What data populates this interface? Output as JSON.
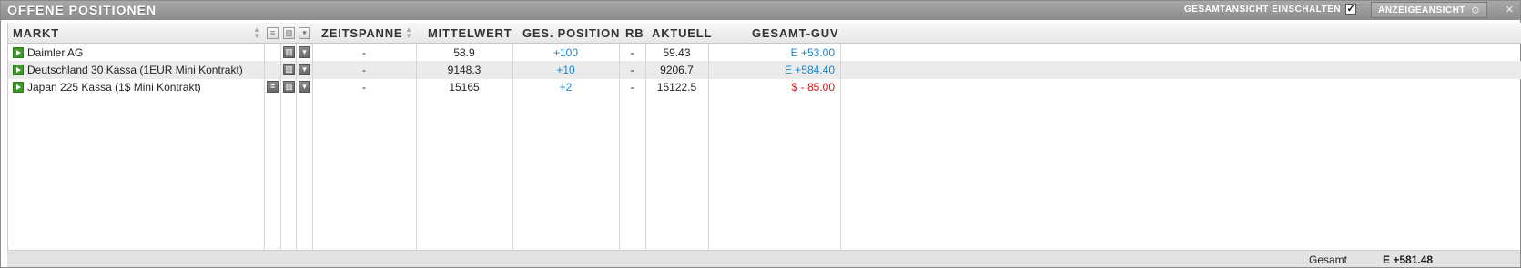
{
  "window": {
    "title": "OFFENE POSITIONEN",
    "overall_toggle_label": "GESAMTANSICHT EINSCHALTEN",
    "overall_toggle_checked": true,
    "view_button_label": "ANZEIGEANSICHT",
    "close_icon": "×"
  },
  "columns": {
    "market": "MARKT",
    "timespan": "ZEITSPANNE",
    "average": "MITTELWERT",
    "total_position": "GES. POSITION",
    "rb": "RB",
    "current": "AKTUELL",
    "total_pnl": "GESAMT-GUV"
  },
  "rows": [
    {
      "market": "Daimler AG",
      "timespan": "-",
      "average": "58.9",
      "total_position": "+100",
      "rb": "-",
      "current": "59.43",
      "total_pnl": "E +53.00",
      "pnl_color": "#1a86c8",
      "has_note_icon": false
    },
    {
      "market": "Deutschland 30 Kassa (1EUR Mini Kontrakt)",
      "timespan": "-",
      "average": "9148.3",
      "total_position": "+10",
      "rb": "-",
      "current": "9206.7",
      "total_pnl": "E +584.40",
      "pnl_color": "#1a86c8",
      "has_note_icon": false
    },
    {
      "market": "Japan 225 Kassa (1$ Mini Kontrakt)",
      "timespan": "-",
      "average": "15165",
      "total_position": "+2",
      "rb": "-",
      "current": "15122.5",
      "total_pnl": "$ - 85.00",
      "pnl_color": "#d01818",
      "has_note_icon": true
    }
  ],
  "footer": {
    "label": "Gesamt",
    "value": "E +581.48"
  },
  "icons": {
    "play": "play-icon",
    "note": "note-icon",
    "chart": "chart-icon",
    "dropdown": "dropdown-icon",
    "sort": "sort-icon",
    "gear": "gear-icon",
    "check": "check-icon"
  }
}
